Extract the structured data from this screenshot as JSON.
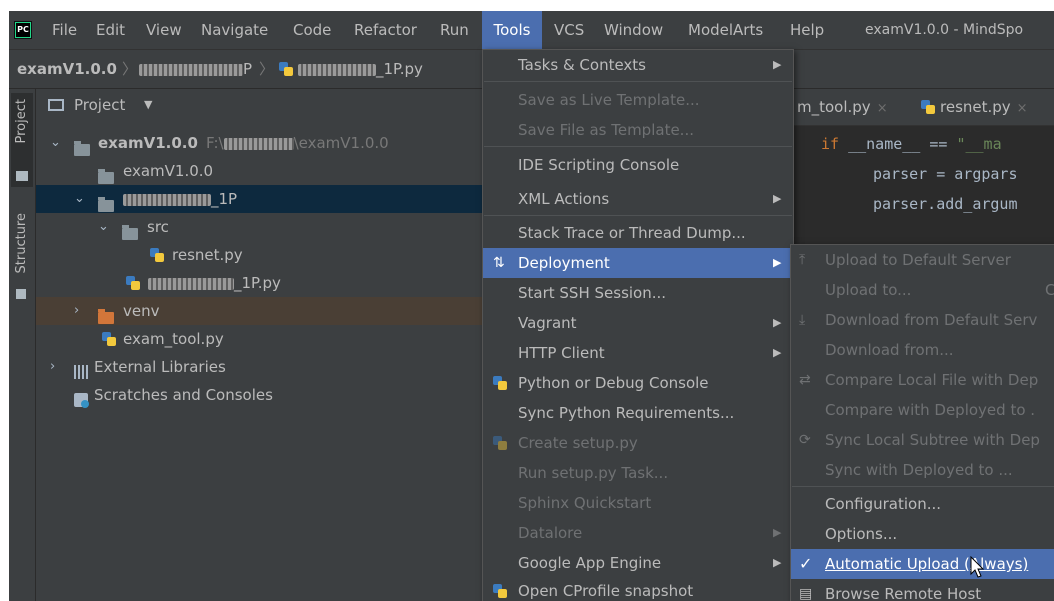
{
  "menubar": {
    "logo_text": "PC",
    "items": [
      "File",
      "Edit",
      "View",
      "Navigate",
      "Code",
      "Refactor",
      "Run",
      "Tools",
      "VCS",
      "Window",
      "ModelArts",
      "Help"
    ],
    "active": "Tools",
    "window_title": "examV1.0.0 - MindSpo"
  },
  "navbar": {
    "project": "examV1.0.0",
    "folder_suffix": "P",
    "file_suffix": "_1P.py"
  },
  "toolstrip": {
    "project_tab": "Project",
    "structure_tab": "Structure"
  },
  "project_panel": {
    "header": "Project",
    "rows": {
      "root_name": "examV1.0.0",
      "root_path_prefix": "F:\\",
      "root_path_suffix": "\\examV1.0.0",
      "examv": "examV1.0.0",
      "folder_suffix": "_1P",
      "src": "src",
      "resnet": "resnet.py",
      "file_suffix": "_1P.py",
      "venv": "venv",
      "exam_tool": "exam_tool.py",
      "external_libraries": "External Libraries",
      "scratches": "Scratches and Consoles"
    }
  },
  "editor": {
    "tab1": "m_tool.py",
    "tab2": "resnet.py",
    "code_line1_kw": "if",
    "code_line1_rest": " __name__ == ",
    "code_line1_str": "\"__ma",
    "code_line2": "parser = argpars",
    "code_line3": "parser.add_argum"
  },
  "tools_menu": {
    "items": {
      "tasks": "Tasks & Contexts",
      "save_live": "Save as Live Template...",
      "save_file": "Save File as Template...",
      "ide_console": "IDE Scripting Console",
      "xml_actions": "XML Actions",
      "stack_trace": "Stack Trace or Thread Dump...",
      "deployment": "Deployment",
      "ssh": "Start SSH Session...",
      "vagrant": "Vagrant",
      "http_client": "HTTP Client",
      "python_console": "Python or Debug Console",
      "sync_requirements": "Sync Python Requirements...",
      "create_setup": "Create setup.py",
      "run_setup": "Run setup.py Task...",
      "sphinx": "Sphinx Quickstart",
      "datalore": "Datalore",
      "google_app_engine": "Google App Engine",
      "cprofile": "Open CProfile snapshot"
    }
  },
  "deployment_menu": {
    "items": {
      "upload_default": "Upload to Default Server",
      "upload_to": "Upload to...",
      "upload_to_shortcut": "C",
      "download_default": "Download from Default Serv",
      "download_from": "Download from...",
      "compare_local": "Compare Local File with Dep",
      "compare_deployed": "Compare with Deployed to .",
      "sync_subtree": "Sync Local Subtree with Dep",
      "sync_deployed": "Sync with Deployed to ...",
      "configuration": "Configuration...",
      "options": "Options...",
      "automatic_upload": "Automatic Upload (Always)",
      "browse_remote": "Browse Remote Host"
    },
    "checked": "Automatic Upload (Always)"
  },
  "colors": {
    "menu_bg": "#3c3f41",
    "highlight": "#4b6eaf",
    "selection": "#0d293e",
    "disabled_text": "#6f7173"
  }
}
